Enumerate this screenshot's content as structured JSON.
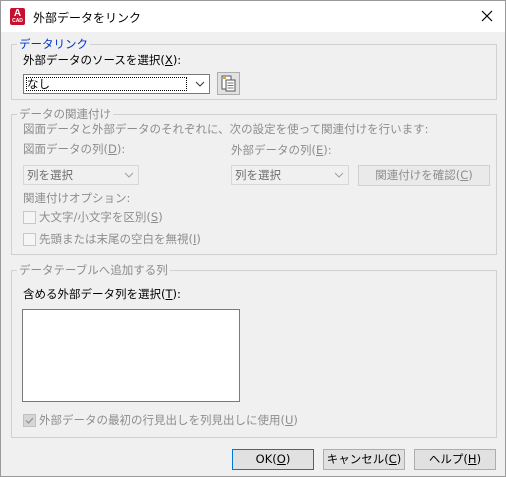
{
  "window": {
    "title": "外部データをリンク",
    "app_icon_letter": "A",
    "app_icon_sub": "CAD"
  },
  "source_group": {
    "legend": "データリンク",
    "label": "外部データのソースを選択(",
    "label_key": "X",
    "label_end": "):",
    "combo_value": "なし"
  },
  "mapping_group": {
    "legend": "データの関連付け",
    "description": "図面データと外部データのそれぞれに、次の設定を使って関連付けを行います:",
    "drawing_col_label": "図面データの列(",
    "drawing_col_key": "D",
    "drawing_col_end": "):",
    "drawing_col_value": "列を選択",
    "external_col_label": "外部データの列(",
    "external_col_key": "E",
    "external_col_end": "):",
    "external_col_value": "列を選択",
    "verify_label": "関連付けを確認(",
    "verify_key": "C",
    "verify_end": ")",
    "options_label": "関連付けオプション:",
    "case_label": "大文字/小文字を区別(",
    "case_key": "S",
    "case_end": ")",
    "whitespace_label": "先頭または末尾の空白を無視(",
    "whitespace_key": "I",
    "whitespace_end": ")"
  },
  "columns_group": {
    "legend": "データテーブルへ追加する列",
    "include_label": "含める外部データ列を選択(",
    "include_key": "T",
    "include_end": "):",
    "header_label": "外部データの最初の行見出しを列見出しに使用(",
    "header_key": "U",
    "header_end": ")"
  },
  "buttons": {
    "ok_label": "OK(",
    "ok_key": "O",
    "ok_end": ")",
    "cancel_label": "キャンセル(",
    "cancel_key": "C",
    "cancel_end": ")",
    "help_label": "ヘルプ(",
    "help_key": "H",
    "help_end": ")"
  },
  "colors": {
    "accent": "#0078d7",
    "legend_active": "#0033cc",
    "disabled_text": "#8d8d8d",
    "icon_red": "#c8102e"
  }
}
